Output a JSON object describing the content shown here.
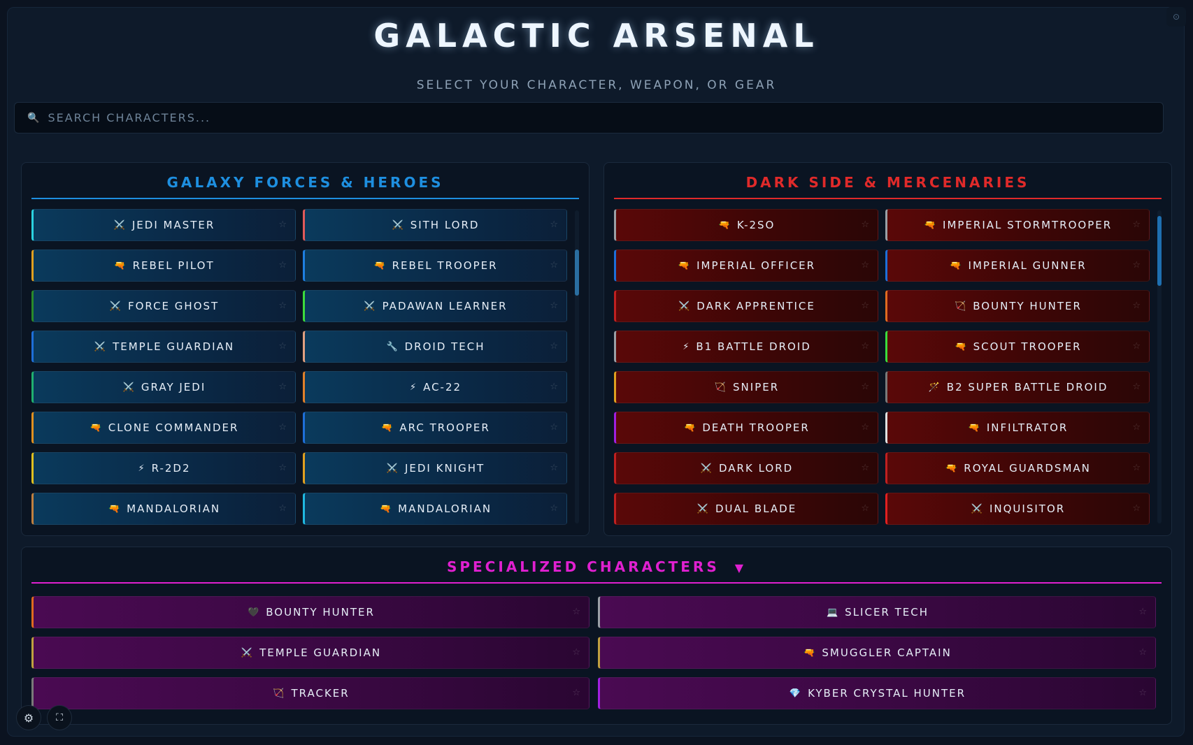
{
  "header": {
    "title": "GALACTIC ARSENAL",
    "subtitle": "SELECT YOUR CHARACTER, WEAPON, OR GEAR",
    "corner_icon": "settings-dot-icon"
  },
  "search": {
    "placeholder": "SEARCH CHARACTERS...",
    "value": ""
  },
  "left_panel": {
    "title": "GALAXY FORCES & HEROES",
    "accent": "#1e8fe0",
    "items": [
      {
        "icon": "⚔️",
        "label": "JEDI MASTER",
        "color": "#2bd2e0"
      },
      {
        "icon": "⚔️",
        "label": "SITH LORD",
        "color": "#e05a5a"
      },
      {
        "icon": "🔫",
        "label": "REBEL PILOT",
        "color": "#e0a020"
      },
      {
        "icon": "🔫",
        "label": "REBEL TROOPER",
        "color": "#1e7fe0"
      },
      {
        "icon": "⚔️",
        "label": "FORCE GHOST",
        "color": "#2a8a2a"
      },
      {
        "icon": "⚔️",
        "label": "PADAWAN LEARNER",
        "color": "#3cdc3c"
      },
      {
        "icon": "⚔️",
        "label": "TEMPLE GUARDIAN",
        "color": "#1e6fd8"
      },
      {
        "icon": "🔧",
        "label": "DROID TECH",
        "color": "#e0a080"
      },
      {
        "icon": "⚔️",
        "label": "GRAY JEDI",
        "color": "#20b070"
      },
      {
        "icon": "⚡",
        "label": "AC-22",
        "color": "#e0802a"
      },
      {
        "icon": "🔫",
        "label": "CLONE COMMANDER",
        "color": "#e09020"
      },
      {
        "icon": "🔫",
        "label": "ARC TROOPER",
        "color": "#1e6fd8"
      },
      {
        "icon": "⚡",
        "label": "R-2D2",
        "color": "#e0c020"
      },
      {
        "icon": "⚔️",
        "label": "JEDI KNIGHT",
        "color": "#e0a020"
      },
      {
        "icon": "🔫",
        "label": "MANDALORIAN",
        "color": "#c08040"
      },
      {
        "icon": "🔫",
        "label": "MANDALORIAN",
        "color": "#20b8e0"
      }
    ]
  },
  "right_panel": {
    "title": "DARK SIDE & MERCENARIES",
    "accent": "#e02a2a",
    "items": [
      {
        "icon": "🔫",
        "label": "K-2SO",
        "color": "#9aa0a6"
      },
      {
        "icon": "🔫",
        "label": "IMPERIAL STORMTROOPER",
        "color": "#9aa0a6"
      },
      {
        "icon": "🔫",
        "label": "IMPERIAL OFFICER",
        "color": "#1e6fd8"
      },
      {
        "icon": "🔫",
        "label": "IMPERIAL GUNNER",
        "color": "#1e6fd8"
      },
      {
        "icon": "⚔️",
        "label": "DARK APPRENTICE",
        "color": "#c02020"
      },
      {
        "icon": "🏹",
        "label": "BOUNTY HUNTER",
        "color": "#e06a20"
      },
      {
        "icon": "⚡",
        "label": "B1 BATTLE DROID",
        "color": "#9aa0a6"
      },
      {
        "icon": "🔫",
        "label": "SCOUT TROOPER",
        "color": "#3cdc3c"
      },
      {
        "icon": "🏹",
        "label": "SNIPER",
        "color": "#e0a020"
      },
      {
        "icon": "🪄",
        "label": "B2 SUPER BATTLE DROID",
        "color": "#7a7a7a"
      },
      {
        "icon": "🔫",
        "label": "DEATH TROOPER",
        "color": "#a020e0"
      },
      {
        "icon": "🔫",
        "label": "INFILTRATOR",
        "color": "#e0e0e0"
      },
      {
        "icon": "⚔️",
        "label": "DARK LORD",
        "color": "#c02020"
      },
      {
        "icon": "🔫",
        "label": "ROYAL GUARDSMAN",
        "color": "#c02020"
      },
      {
        "icon": "⚔️",
        "label": "DUAL BLADE",
        "color": "#c02020"
      },
      {
        "icon": "⚔️",
        "label": "INQUISITOR",
        "color": "#e02020"
      }
    ]
  },
  "bottom_panel": {
    "title": "SPECIALIZED CHARACTERS",
    "accent": "#e020d0",
    "caret": "▼",
    "items": [
      {
        "icon": "🖤",
        "label": "BOUNTY HUNTER",
        "color": "#e06a20"
      },
      {
        "icon": "💻",
        "label": "SLICER TECH",
        "color": "#9aa0a6"
      },
      {
        "icon": "⚔️",
        "label": "TEMPLE GUARDIAN",
        "color": "#c0a040"
      },
      {
        "icon": "🔫",
        "label": "SMUGGLER CAPTAIN",
        "color": "#c0a040"
      },
      {
        "icon": "🏹",
        "label": "TRACKER",
        "color": "#7a7a7a"
      },
      {
        "icon": "💎",
        "label": "KYBER CRYSTAL HUNTER",
        "color": "#a020e0"
      }
    ]
  },
  "footer": {
    "settings_icon": "⚙",
    "fullscreen_icon": "⛶"
  }
}
